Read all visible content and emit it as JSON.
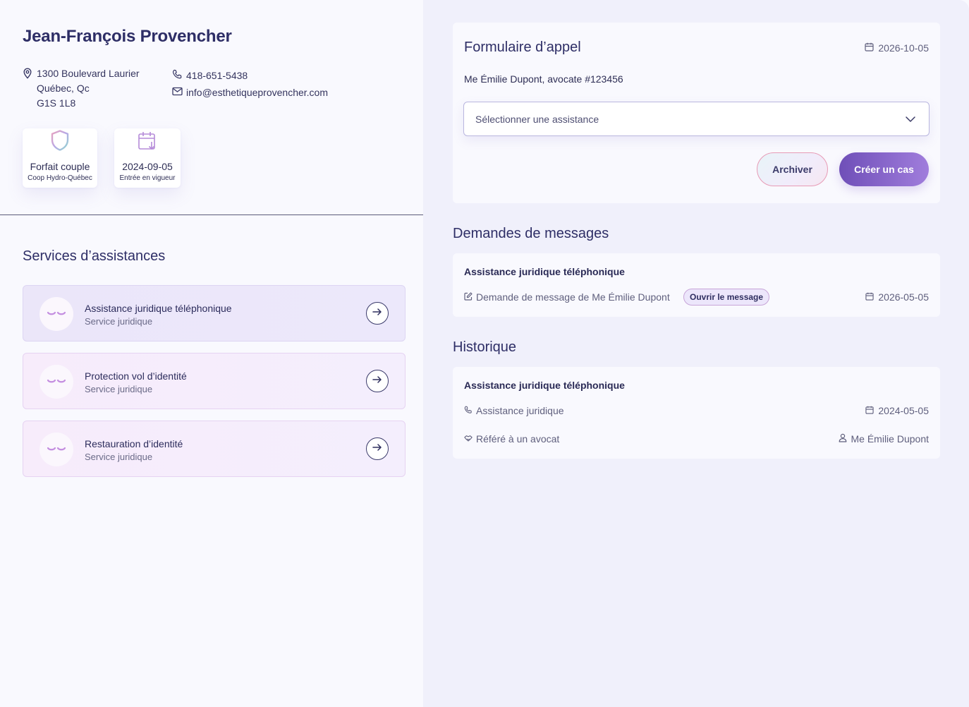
{
  "client": {
    "name": "Jean-François Provencher",
    "address_line1": "1300 Boulevard Laurier",
    "address_line2": "Québec, Qc",
    "address_line3": "G1S 1L8",
    "phone": "418-651-5438",
    "email": "info@esthetiqueprovencher.com"
  },
  "chips": [
    {
      "title": "Forfait couple",
      "subtitle": "Coop Hydro-Québec",
      "icon": "shield-icon"
    },
    {
      "title": "2024-09-05",
      "subtitle": "Entrée en vigueur",
      "icon": "calendar-download-icon"
    }
  ],
  "services": {
    "title": "Services d’assistances",
    "items": [
      {
        "title": "Assistance juridique téléphonique",
        "subtitle": "Service juridique"
      },
      {
        "title": "Protection vol d’identité",
        "subtitle": "Service juridique"
      },
      {
        "title": "Restauration d’identité",
        "subtitle": "Service juridique"
      }
    ]
  },
  "form": {
    "title": "Formulaire d’appel",
    "date": "2026-10-05",
    "lawyer": "Me Émilie Dupont, avocate #123456",
    "select_placeholder": "Sélectionner une assistance",
    "archive_label": "Archiver",
    "create_label": "Créer un cas"
  },
  "messages": {
    "title": "Demandes de messages",
    "card_title": "Assistance juridique téléphonique",
    "request": "Demande de message de Me Émilie Dupont",
    "open_label": "Ouvrir le message",
    "date": "2026-05-05"
  },
  "history": {
    "title": "Historique",
    "card_title": "Assistance juridique téléphonique",
    "type": "Assistance juridique",
    "date": "2024-05-05",
    "referral": "Référé à un avocat",
    "lawyer": "Me Émilie Dupont"
  },
  "colors": {
    "accent": "#6f4fb8",
    "accent_light": "#a07ddc",
    "text_dark": "#2e2e66",
    "right_bg": "#f0f0fb"
  }
}
